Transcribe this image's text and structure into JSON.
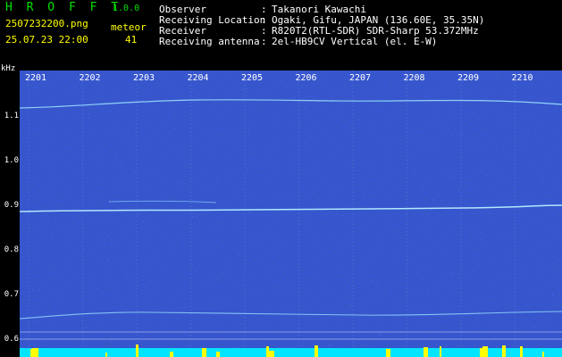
{
  "app": {
    "title": "H R O F F T",
    "version": "1.0.0"
  },
  "file": {
    "name": "2507232200.png",
    "datetime": "25.07.23 22:00"
  },
  "meteor": {
    "label": "meteor",
    "count": "41"
  },
  "info": [
    {
      "label": "Observer",
      "value": "Takanori Kawachi"
    },
    {
      "label": "Receiving Location",
      "value": "Ogaki, Gifu, JAPAN (136.60E, 35.35N)"
    },
    {
      "label": "Receiver",
      "value": "R820T2(RTL-SDR) SDR-Sharp 53.372MHz"
    },
    {
      "label": "Receiving antenna",
      "value": "2el-HB9CV Vertical (el. E-W)"
    }
  ],
  "axis": {
    "y_unit": "kHz",
    "y_ticks": [
      "1.1",
      "1.0",
      "0.9",
      "0.8",
      "0.7",
      "0.6"
    ],
    "x_ticks": [
      "2201",
      "2202",
      "2203",
      "2204",
      "2205",
      "2206",
      "2207",
      "2208",
      "2209",
      "2210"
    ]
  },
  "colors": {
    "background": "#0a1a8a",
    "trace": "#9fe8ff",
    "header_green": "#00e000",
    "header_white": "#ffffff",
    "header_yellow": "#ffff00",
    "baseline": "#00e5ff",
    "baseline_peak": "#ffff00"
  }
}
